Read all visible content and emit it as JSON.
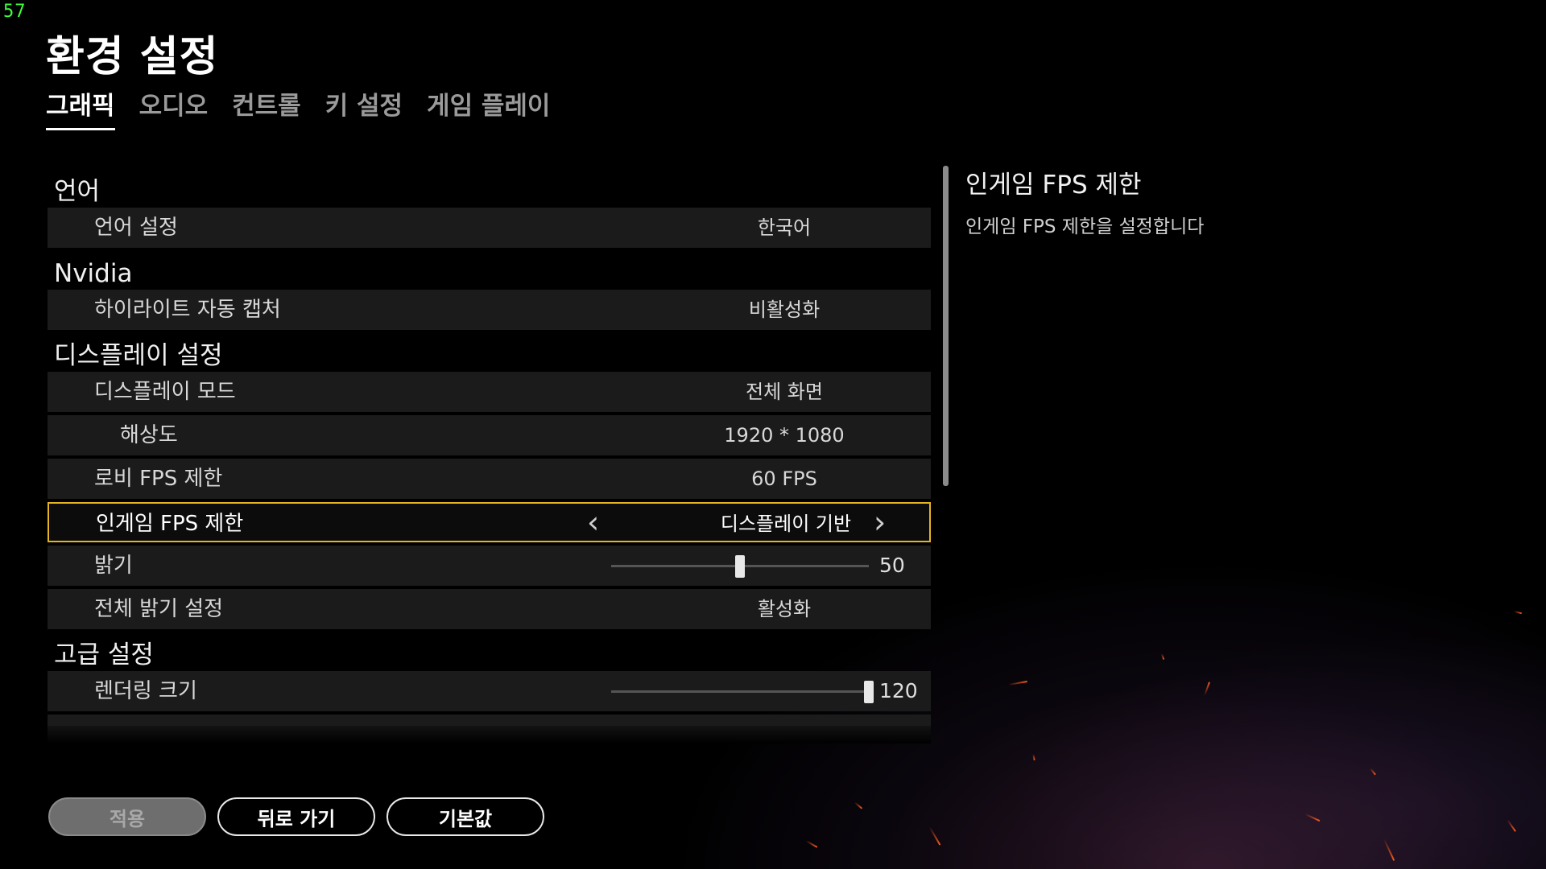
{
  "fps_counter": "57",
  "title": "환경 설정",
  "tabs": [
    {
      "label": "그래픽",
      "active": true
    },
    {
      "label": "오디오",
      "active": false
    },
    {
      "label": "컨트롤",
      "active": false
    },
    {
      "label": "키 설정",
      "active": false
    },
    {
      "label": "게임 플레이",
      "active": false
    }
  ],
  "sections": {
    "language": {
      "header": "언어",
      "language_setting": {
        "label": "언어 설정",
        "value": "한국어"
      }
    },
    "nvidia": {
      "header": "Nvidia",
      "highlight_capture": {
        "label": "하이라이트 자동 캡처",
        "value": "비활성화"
      }
    },
    "display": {
      "header": "디스플레이 설정",
      "display_mode": {
        "label": "디스플레이 모드",
        "value": "전체 화면"
      },
      "resolution": {
        "label": "해상도",
        "value": "1920 * 1080"
      },
      "lobby_fps": {
        "label": "로비 FPS 제한",
        "value": "60 FPS"
      },
      "ingame_fps": {
        "label": "인게임 FPS 제한",
        "value": "디스플레이 기반",
        "selected": true
      },
      "brightness": {
        "label": "밝기",
        "value": "50",
        "min": 0,
        "max": 100
      },
      "global_brightness": {
        "label": "전체 밝기 설정",
        "value": "활성화"
      }
    },
    "advanced": {
      "header": "고급 설정",
      "render_scale": {
        "label": "렌더링 크기",
        "value": "120",
        "min": 70,
        "max": 120
      }
    }
  },
  "description": {
    "title": "인게임 FPS 제한",
    "text": "인게임 FPS 제한을 설정합니다"
  },
  "buttons": {
    "apply": "적용",
    "back": "뒤로 가기",
    "defaults": "기본값"
  },
  "colors": {
    "selection_border": "#e6b422",
    "fps_counter": "#3cff3c",
    "row_background": "#1b1b1b"
  },
  "icons": {
    "prev": "chevron-left-icon",
    "next": "chevron-right-icon"
  }
}
